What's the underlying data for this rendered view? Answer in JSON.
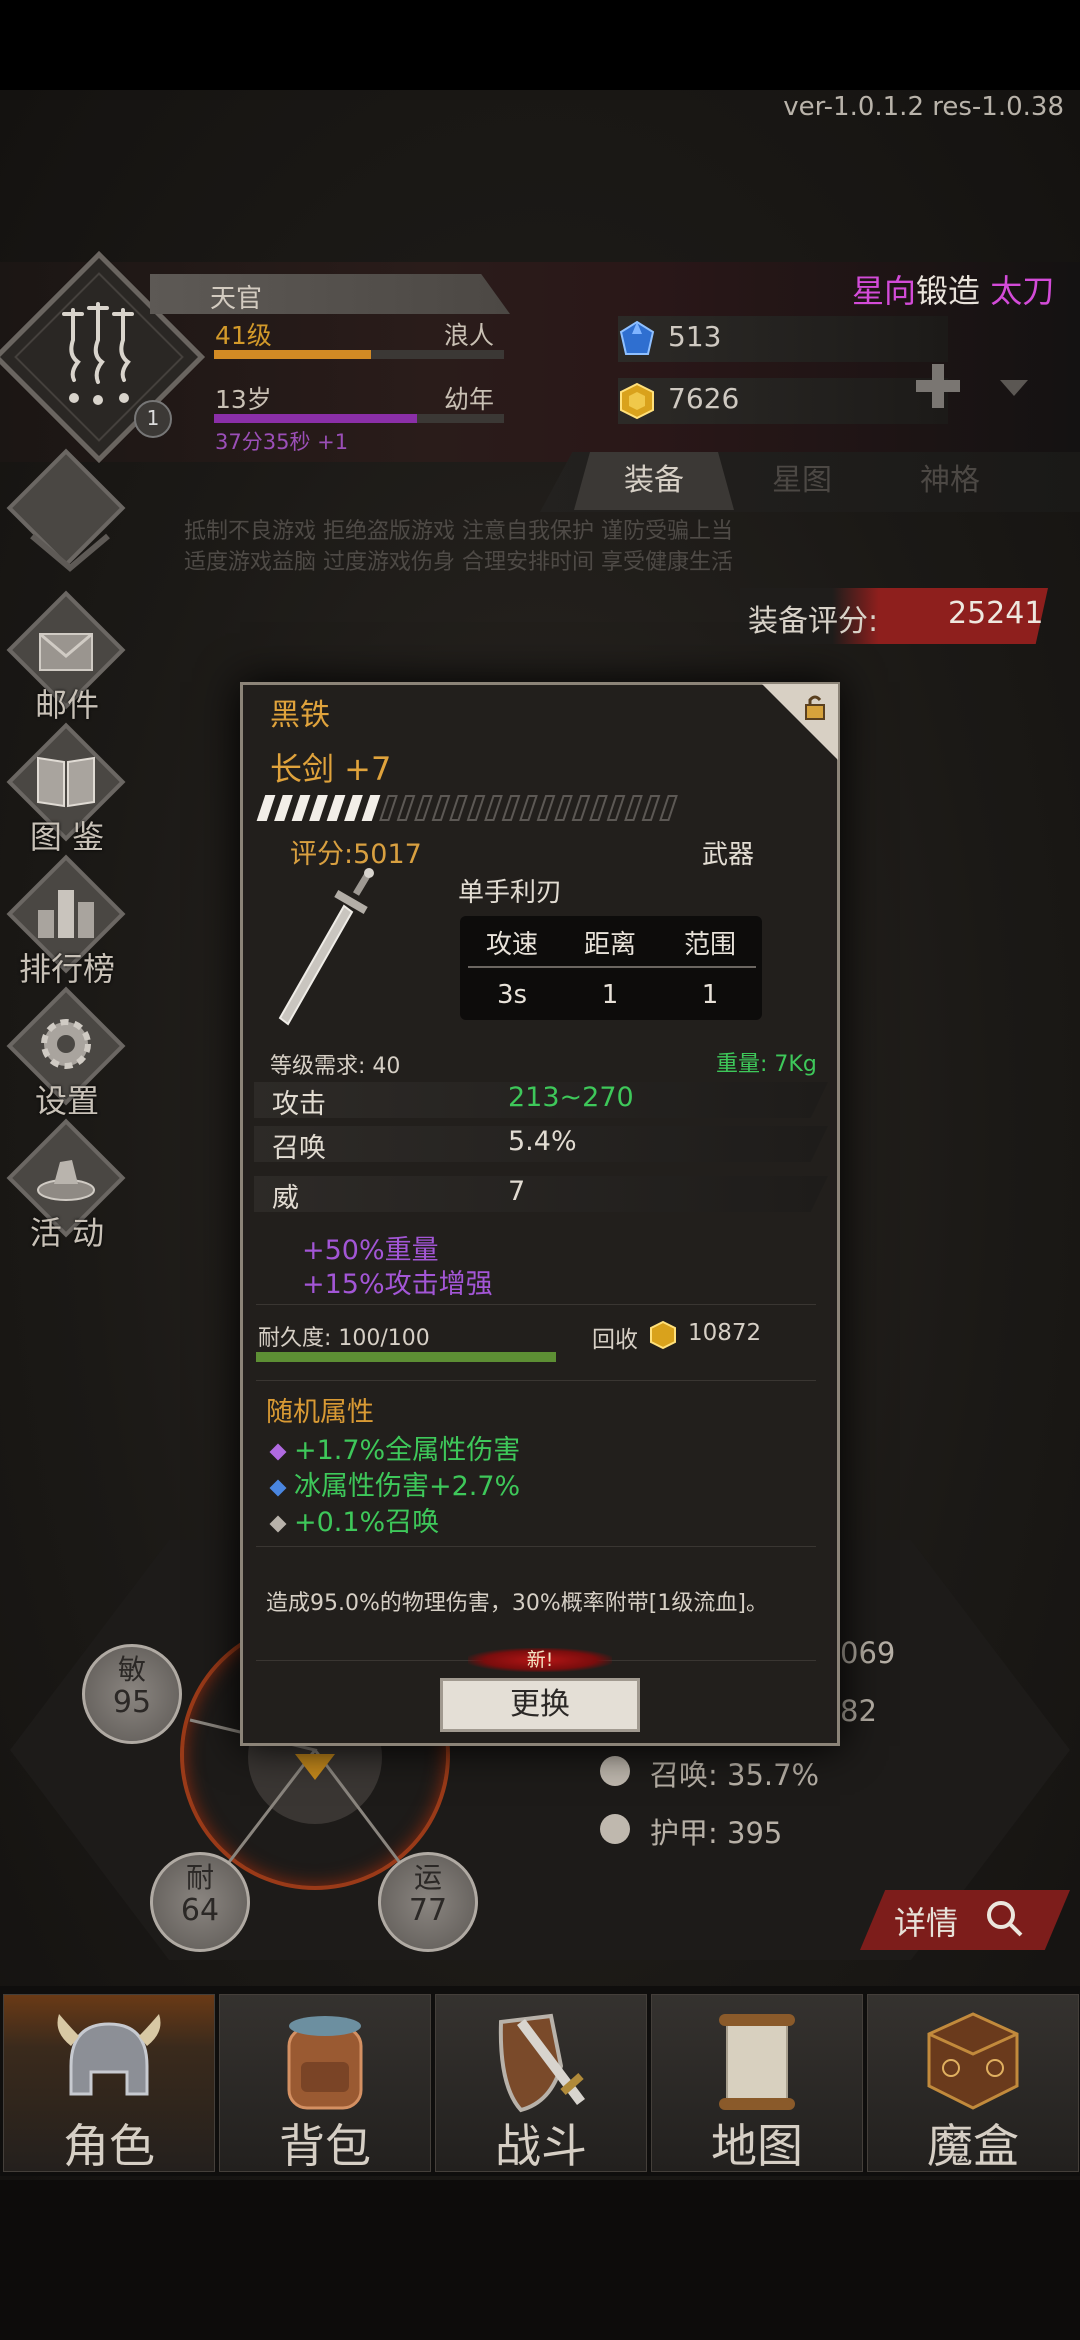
{
  "app": {
    "version": "ver-1.0.1.2  res-1.0.38"
  },
  "player": {
    "name": "天官",
    "level": "41级",
    "class": "浪人",
    "level_progress": 0.54,
    "age": "13岁",
    "stage": "幼年",
    "age_progress": 0.7,
    "timer": "37分35秒 +1",
    "avatar_badge": "1"
  },
  "resources": [
    {
      "icon": "blue-gem-icon",
      "value": "513"
    },
    {
      "icon": "gold-gem-icon",
      "value": "7626"
    }
  ],
  "marquee": {
    "part1": "星向",
    "part2": "锻造",
    "part3": "太刀"
  },
  "tabs": [
    {
      "label": "装备",
      "active": true
    },
    {
      "label": "星图",
      "active": false
    },
    {
      "label": "神格",
      "active": false
    }
  ],
  "notice": {
    "line1": "抵制不良游戏 拒绝盗版游戏 注意自我保护 谨防受骗上当",
    "line2": "适度游戏益脑 过度游戏伤身 合理安排时间 享受健康生活"
  },
  "equip_score": {
    "label": "装备评分:",
    "value": "25241"
  },
  "side_menu": [
    {
      "id": "mail",
      "label": "邮件"
    },
    {
      "id": "codex",
      "label": "图 鉴"
    },
    {
      "id": "rank",
      "label": "排行榜"
    },
    {
      "id": "settings",
      "label": "设置"
    },
    {
      "id": "events",
      "label": "活 动"
    }
  ],
  "attributes": [
    {
      "key": "敏",
      "value": "95"
    },
    {
      "key": "耐",
      "value": "64"
    },
    {
      "key": "运",
      "value": "77"
    }
  ],
  "bg_stats": {
    "partial1": "069",
    "partial2": "82",
    "summon": "召唤: 35.7%",
    "armor": "护甲: 395"
  },
  "detail_button": "详情",
  "bottom_nav": [
    {
      "label": "角色",
      "active": true
    },
    {
      "label": "背包",
      "active": false
    },
    {
      "label": "战斗",
      "active": false
    },
    {
      "label": "地图",
      "active": false
    },
    {
      "label": "魔盒",
      "active": false
    }
  ],
  "item": {
    "material": "黑铁",
    "name": "长剑 +7",
    "quality_progress": 0.3,
    "score": "评分:5017",
    "type": "武器",
    "sub_type": "单手利刃",
    "spec_headers": [
      "攻速",
      "距离",
      "范围"
    ],
    "spec_values": [
      "3s",
      "1",
      "1"
    ],
    "level_req": "等级需求: 40",
    "weight": "重量: 7Kg",
    "attrs": [
      {
        "key": "攻击",
        "value": "213~270",
        "color": "#3ec85a"
      },
      {
        "key": "召唤",
        "value": "5.4%",
        "color": "#e2dcd2"
      },
      {
        "key": "威",
        "value": "7",
        "color": "#e2dcd2"
      }
    ],
    "bonuses": [
      "+50%重量",
      "+15%攻击增强"
    ],
    "durability_label": "耐久度: 100/100",
    "durability_ratio": 1.0,
    "recycle_label": "回收",
    "recycle_value": "10872",
    "random_title": "随机属性",
    "random_attrs": [
      {
        "text": "+1.7%全属性伤害",
        "dot_color": "#b06ae0"
      },
      {
        "text": "冰属性伤害+2.7%",
        "dot_color": "#4a86e0"
      },
      {
        "text": "+0.1%召唤",
        "dot_color": "#b8b2aa"
      }
    ],
    "effect": "造成95.0%的物理伤害，30%概率附带[1级流血]。",
    "new_badge": "新!",
    "swap_button": "更换"
  }
}
